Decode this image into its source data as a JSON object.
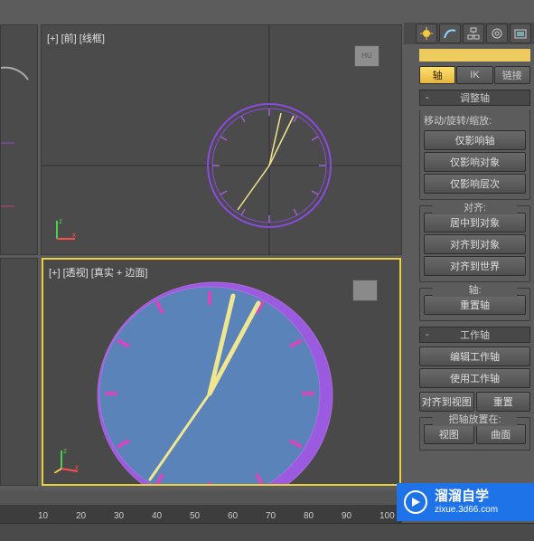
{
  "viewports": {
    "top": {
      "label": "[+] [前] [线框]"
    },
    "bottom": {
      "label": "[+] [透视] [真实 + 边面]"
    }
  },
  "axes": {
    "z": "z",
    "x": "x"
  },
  "viewcube": "HU",
  "panel": {
    "tabs": {
      "axis": "轴",
      "ik": "IK",
      "link": "链接"
    },
    "adjust_axis": {
      "title": "调整轴",
      "move_rotate_scale": "移动/旋转/缩放:",
      "only_pivot": "仅影响轴",
      "only_object": "仅影响对象",
      "only_hierarchy": "仅影响层次"
    },
    "align": {
      "title": "对齐:",
      "center_to_object": "居中到对象",
      "align_to_object": "对齐到对象",
      "align_to_world": "对齐到世界"
    },
    "pivot": {
      "title": "轴:",
      "reset_pivot": "重置轴"
    },
    "working_pivot": {
      "title": "工作轴",
      "edit": "编辑工作轴",
      "use": "使用工作轴",
      "align_to_view": "对齐到视图",
      "reset": "重置"
    },
    "place_pivot": {
      "title": "把轴放置在:",
      "view": "视图",
      "surface": "曲面"
    }
  },
  "timeline": {
    "ticks": [
      "10",
      "20",
      "30",
      "40",
      "50",
      "60",
      "70",
      "80",
      "90",
      "100"
    ]
  },
  "watermark": {
    "cn": "溜溜自学",
    "url": "zixue.3d66.com"
  },
  "clock": {
    "outer_color": "#9a5be0",
    "tick_color": "#c566c0",
    "face_color": "#5a83b9",
    "hand_color": "#f0e690"
  }
}
